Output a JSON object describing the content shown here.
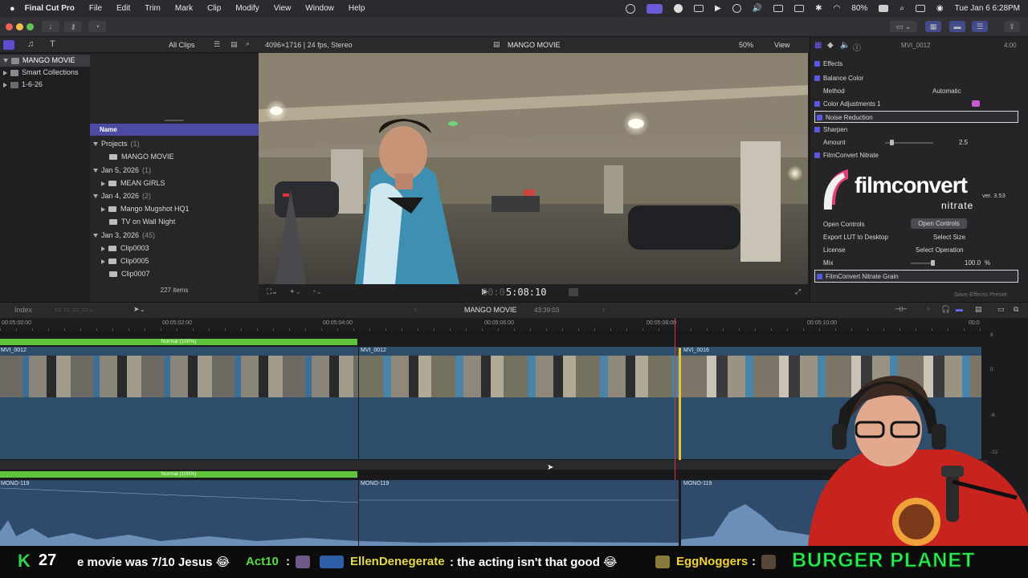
{
  "menubar": {
    "app": "Final Cut Pro",
    "items": [
      "File",
      "Edit",
      "Trim",
      "Mark",
      "Clip",
      "Modify",
      "View",
      "Window",
      "Help"
    ],
    "battery": "80%",
    "datetime": "Tue Jan 6  6:28PM"
  },
  "browser": {
    "filter": "All Clips",
    "library": "MANGO MOVIE",
    "library_items": [
      "Smart Collections",
      "1-6-26"
    ],
    "column_name": "Name",
    "rows": [
      {
        "label": "Projects",
        "count": "(1)",
        "level": 0,
        "open": true
      },
      {
        "label": "MANGO MOVIE",
        "count": "",
        "level": 2,
        "open": null
      },
      {
        "label": "Jan 5, 2026",
        "count": "(1)",
        "level": 0,
        "open": true
      },
      {
        "label": "MEAN GIRLS",
        "count": "",
        "level": 1,
        "open": false
      },
      {
        "label": "Jan 4, 2026",
        "count": "(2)",
        "level": 0,
        "open": true
      },
      {
        "label": "Mango Mugshot HQ1",
        "count": "",
        "level": 1,
        "open": false
      },
      {
        "label": "TV on Wall Night",
        "count": "",
        "level": 2,
        "open": null
      },
      {
        "label": "Jan 3, 2026",
        "count": "(45)",
        "level": 0,
        "open": true
      },
      {
        "label": "Clip0003",
        "count": "",
        "level": 1,
        "open": false
      },
      {
        "label": "Clip0005",
        "count": "",
        "level": 1,
        "open": false
      },
      {
        "label": "Clip0007",
        "count": "",
        "level": 2,
        "open": null
      }
    ],
    "item_count": "227 items"
  },
  "viewer": {
    "format": "4096×1716 | 24 fps, Stereo",
    "title": "MANGO MOVIE",
    "zoom": "50%",
    "view_label": "View",
    "timecode_prefix": "00:0",
    "timecode": "5:08:10"
  },
  "inspector": {
    "clip": "MVI_0012",
    "duration": "4:00",
    "rows": {
      "effects": "Effects",
      "balance_color": "Balance Color",
      "method_label": "Method",
      "method_value": "Automatic",
      "color_adjustments": "Color Adjustments 1",
      "noise_reduction": "Noise Reduction",
      "sharpen": "Sharpen",
      "amount_label": "Amount",
      "amount_value": "2.5",
      "filmconvert": "FilmConvert Nitrate",
      "open_controls_label": "Open Controls",
      "open_controls_button": "Open Controls",
      "export_lut_label": "Export LUT to Desktop",
      "export_lut_value": "Select Size",
      "license_label": "License",
      "license_value": "Select Operation",
      "mix_label": "Mix",
      "mix_value": "100.0",
      "mix_unit": "%",
      "grain": "FilmConvert Nitrate Grain",
      "save_preset": "Save Effects Preset"
    },
    "logo": {
      "word": "filmconvert",
      "sub": "nitrate",
      "version": "ver. 3.53"
    }
  },
  "timeline": {
    "index": "Index",
    "project": "MANGO MOVIE",
    "duration": "43:39:03",
    "ruler": [
      "00:05:00:00",
      "00:05:02:00",
      "00:05:04:00",
      "00:05:06:00",
      "00:05:08:00",
      "00:05:10:00",
      "00:0"
    ],
    "clips": [
      "MVI_0012",
      "MVI_0012",
      "MVI_0016"
    ],
    "retime": "Normal (100%)",
    "audio": [
      "MONO-119",
      "MONO-119",
      "MONO-119"
    ],
    "meter": [
      "6",
      "0",
      "-6",
      "-12"
    ]
  },
  "chat": {
    "count": "27",
    "text1": "e movie was 7/10 Jesus 😂",
    "user1": "Act10",
    "user2": "EllenDenegerate",
    "text2": ": the acting isn't that good 😂",
    "user3": "EggNoggers",
    "sep": ":",
    "banner": "BURGER PLANET"
  }
}
